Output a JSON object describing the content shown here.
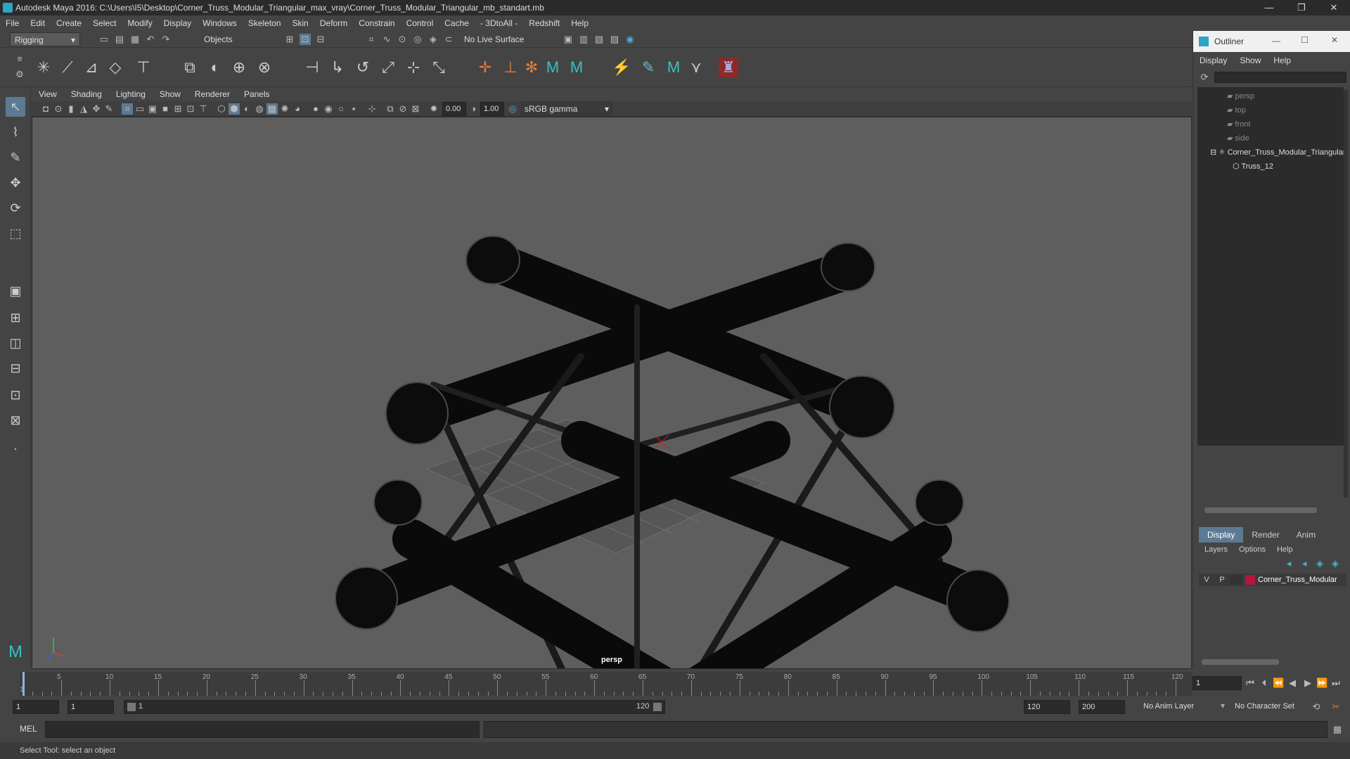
{
  "window": {
    "title": "Autodesk Maya 2016: C:\\Users\\I5\\Desktop\\Corner_Truss_Modular_Triangular_max_vray\\Corner_Truss_Modular_Triangular_mb_standart.mb",
    "min": "—",
    "max": "❐",
    "close": "✕"
  },
  "menu": [
    "File",
    "Edit",
    "Create",
    "Select",
    "Modify",
    "Display",
    "Windows",
    "Skeleton",
    "Skin",
    "Deform",
    "Constrain",
    "Control",
    "Cache",
    "- 3DtoAll -",
    "Redshift",
    "Help"
  ],
  "shelf": {
    "mode": "Rigging",
    "select_mode": "Objects",
    "live_surface": "No Live Surface"
  },
  "viewport": {
    "menu": [
      "View",
      "Shading",
      "Lighting",
      "Show",
      "Renderer",
      "Panels"
    ],
    "exposure": "0.00",
    "gamma": "1.00",
    "colorspace": "sRGB gamma",
    "camera": "persp"
  },
  "outliner": {
    "title": "Outliner",
    "menu": [
      "Display",
      "Show",
      "Help"
    ],
    "items": [
      {
        "label": "persp"
      },
      {
        "label": "top"
      },
      {
        "label": "front"
      },
      {
        "label": "side"
      },
      {
        "label": "Corner_Truss_Modular_Triangular"
      },
      {
        "label": "Truss_12"
      }
    ]
  },
  "layers": {
    "tabs": [
      "Display",
      "Render",
      "Anim"
    ],
    "menu": [
      "Layers",
      "Options",
      "Help"
    ],
    "v": "V",
    "p": "P",
    "layer_name": "Corner_Truss_Modular",
    "layer_color": "#b3163a"
  },
  "timeline": {
    "ticks": [
      "5",
      "10",
      "15",
      "20",
      "25",
      "30",
      "35",
      "40",
      "45",
      "50",
      "55",
      "60",
      "65",
      "70",
      "75",
      "80",
      "85",
      "90",
      "95",
      "100",
      "105",
      "110",
      "115",
      "120"
    ],
    "current": "1",
    "start_label": "1"
  },
  "range": {
    "start": "1",
    "playback_start": "1",
    "slider_start": "1",
    "slider_end": "120",
    "end": "120",
    "anim_end": "200",
    "anim_layer": "No Anim Layer",
    "char_set": "No Character Set"
  },
  "cmd": {
    "label": "MEL"
  },
  "status": "Select Tool: select an object"
}
